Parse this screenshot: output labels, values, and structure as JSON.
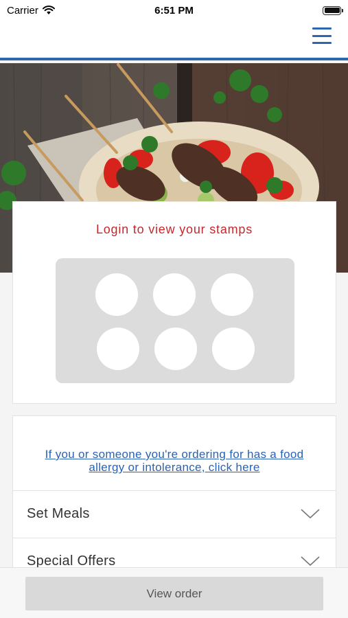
{
  "status_bar": {
    "carrier": "Carrier",
    "time": "6:51 PM"
  },
  "header": {
    "menu_icon": "hamburger-icon",
    "accent_color": "#2e66b0"
  },
  "hero": {
    "image_subject": "kebab-skewers-photo"
  },
  "stamps": {
    "title": "Login to view your stamps",
    "count": 6,
    "title_color": "#c8262a"
  },
  "allergy": {
    "link_line1": "If you or someone you're ordering for has a food",
    "link_line2": "allergy or intolerance, click here",
    "link_color": "#2a62b3"
  },
  "menu": {
    "categories": [
      {
        "label": "Set Meals"
      },
      {
        "label": "Special Offers"
      }
    ],
    "chevron_icon": "chevron-down-icon"
  },
  "footer": {
    "view_order_label": "View order"
  }
}
